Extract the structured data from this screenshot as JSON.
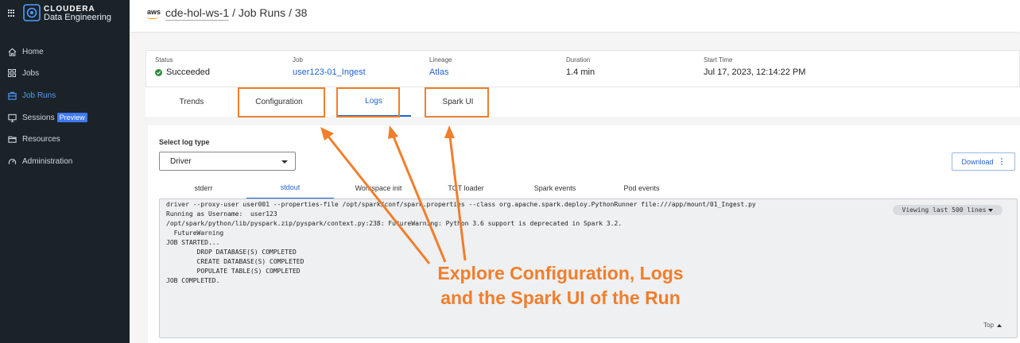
{
  "sidebar": {
    "brand": {
      "name": "CLOUDERA",
      "sub": "Data Engineering"
    },
    "items": [
      {
        "label": "Home",
        "icon": "home-icon"
      },
      {
        "label": "Jobs",
        "icon": "jobs-icon"
      },
      {
        "label": "Job Runs",
        "icon": "job-runs-icon",
        "active": true
      },
      {
        "label": "Sessions",
        "icon": "sessions-icon",
        "badge": "Preview"
      },
      {
        "label": "Resources",
        "icon": "folder-icon"
      },
      {
        "label": "Administration",
        "icon": "gauge-icon"
      }
    ]
  },
  "header": {
    "cloud": "aws",
    "workspace": "cde-hol-ws-1",
    "section": "/ Job Runs",
    "run": "/ 38"
  },
  "summary": {
    "status": {
      "label": "Status",
      "value": "Succeeded"
    },
    "job": {
      "label": "Job",
      "value": "user123-01_Ingest"
    },
    "lineage": {
      "label": "Lineage",
      "value": "Atlas"
    },
    "duration": {
      "label": "Duration",
      "value": "1.4 min"
    },
    "start_time": {
      "label": "Start Time",
      "value": "Jul 17, 2023, 12:14:22 PM"
    }
  },
  "tabs": [
    "Trends",
    "Configuration",
    "Logs",
    "Spark UI"
  ],
  "active_tab": "Logs",
  "logs": {
    "select_label": "Select log type",
    "log_type": "Driver",
    "download_label": "Download",
    "subtabs": [
      "stderr",
      "stdout",
      "Workspace init",
      "TGT loader",
      "Spark events",
      "Pod events"
    ],
    "active_subtab": "stdout",
    "viewing_label": "Viewing last 500 lines",
    "top_label": "Top",
    "lines": [
      "driver --proxy-user user001 --properties-file /opt/spark/conf/spark.properties --class org.apache.spark.deploy.PythonRunner file:///app/mount/01_Ingest.py",
      "Running as Username:  user123",
      "/opt/spark/python/lib/pyspark.zip/pyspark/context.py:238: FutureWarning: Python 3.6 support is deprecated in Spark 3.2.",
      "  FutureWarning",
      "JOB STARTED...",
      "        DROP DATABASE(S) COMPLETED",
      "        CREATE DATABASE(S) COMPLETED",
      "        POPULATE TABLE(S) COMPLETED",
      "JOB COMPLETED."
    ]
  },
  "annotation": {
    "line1": "Explore Configuration, Logs",
    "line2": "and the Spark UI of the Run",
    "color": "#f07e2c"
  }
}
